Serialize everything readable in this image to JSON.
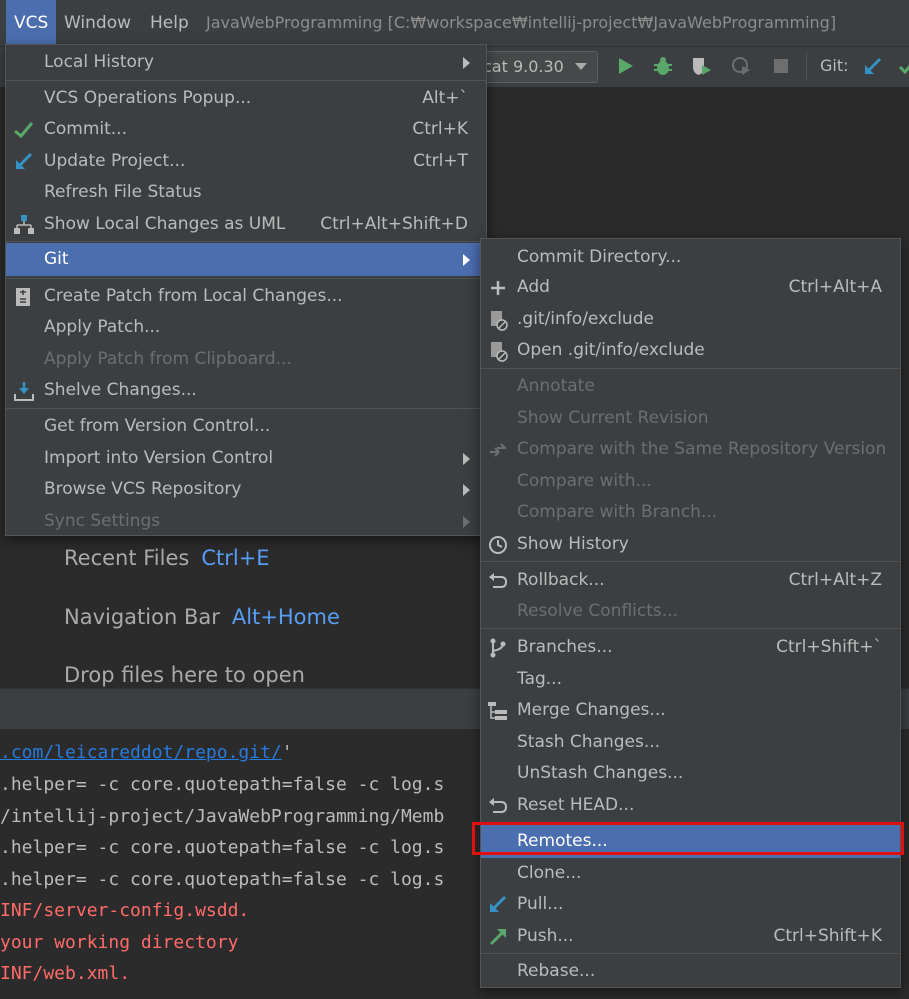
{
  "menubar": {
    "vcs": "VCS",
    "window": "Window",
    "help": "Help",
    "title": "JavaWebProgramming [C:₩workspace₩intellij-project₩JavaWebProgramming]"
  },
  "toolbar": {
    "run_config": "cat 9.0.30",
    "git_label": "Git:"
  },
  "welcome": {
    "recent_files": "Recent Files",
    "recent_files_key": "Ctrl+E",
    "nav_bar": "Navigation Bar",
    "nav_bar_key": "Alt+Home",
    "drop_files": "Drop files here to open"
  },
  "console": {
    "lines": [
      ".com/leicareddot/repo.git/",
      "'",
      ".helper= -c core.quotepath=false -c log.s",
      "/intellij-project/JavaWebProgramming/Memb",
      ".helper= -c core.quotepath=false -c log.s",
      ".helper= -c core.quotepath=false -c log.s",
      "INF/server-config.wsdd.",
      "your working directory",
      "INF/web.xml."
    ]
  },
  "vcs_menu": {
    "local_history": "Local History",
    "vcs_operations_popup": "VCS Operations Popup...",
    "vcs_operations_popup_sc": "Alt+`",
    "commit": "Commit...",
    "commit_sc": "Ctrl+K",
    "update_project": "Update Project...",
    "update_project_sc": "Ctrl+T",
    "refresh_file_status": "Refresh File Status",
    "show_local_changes_uml": "Show Local Changes as UML",
    "show_local_changes_uml_sc": "Ctrl+Alt+Shift+D",
    "git": "Git",
    "create_patch": "Create Patch from Local Changes...",
    "apply_patch": "Apply Patch...",
    "apply_patch_clipboard": "Apply Patch from Clipboard...",
    "shelve_changes": "Shelve Changes...",
    "get_from_vc": "Get from Version Control...",
    "import_into_vc": "Import into Version Control",
    "browse_vcs_repo": "Browse VCS Repository",
    "sync_settings": "Sync Settings"
  },
  "git_menu": {
    "commit_directory": "Commit Directory...",
    "add": "Add",
    "add_sc": "Ctrl+Alt+A",
    "git_info_exclude": ".git/info/exclude",
    "open_git_info_exclude": "Open .git/info/exclude",
    "annotate": "Annotate",
    "show_current_revision": "Show Current Revision",
    "compare_same_repo": "Compare with the Same Repository Version",
    "compare_with": "Compare with...",
    "compare_with_branch": "Compare with Branch...",
    "show_history": "Show History",
    "rollback": "Rollback...",
    "rollback_sc": "Ctrl+Alt+Z",
    "resolve_conflicts": "Resolve Conflicts...",
    "branches": "Branches...",
    "branches_sc": "Ctrl+Shift+`",
    "tag": "Tag...",
    "merge_changes": "Merge Changes...",
    "stash_changes": "Stash Changes...",
    "unstash_changes": "UnStash Changes...",
    "reset_head": "Reset HEAD...",
    "remotes": "Remotes...",
    "clone": "Clone...",
    "pull": "Pull...",
    "push": "Push...",
    "push_sc": "Ctrl+Shift+K",
    "rebase": "Rebase..."
  },
  "colors": {
    "selection": "#4b6eaf",
    "highlight_box": "#e01010",
    "link": "#287bde",
    "error_text": "#ff6b68"
  }
}
